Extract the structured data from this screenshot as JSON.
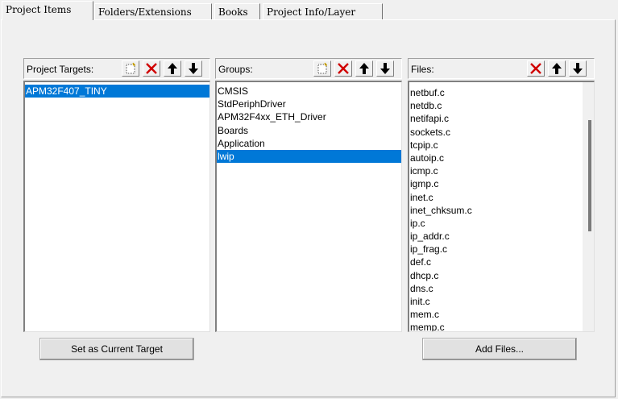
{
  "tabs": [
    {
      "label": "Project Items"
    },
    {
      "label": "Folders/Extensions"
    },
    {
      "label": "Books"
    },
    {
      "label": "Project Info/Layer"
    }
  ],
  "targets_panel": {
    "title": "Project Targets:",
    "items": [
      "APM32F407_TINY"
    ],
    "selected": "APM32F407_TINY"
  },
  "groups_panel": {
    "title": "Groups:",
    "items": [
      "CMSIS",
      "StdPeriphDriver",
      "APM32F4xx_ETH_Driver",
      "Boards",
      "Application",
      "lwip"
    ],
    "selected": "lwip"
  },
  "files_panel": {
    "title": "Files:",
    "items": [
      "netbuf.c",
      "netdb.c",
      "netifapi.c",
      "sockets.c",
      "tcpip.c",
      "autoip.c",
      "icmp.c",
      "igmp.c",
      "inet.c",
      "inet_chksum.c",
      "ip.c",
      "ip_addr.c",
      "ip_frag.c",
      "def.c",
      "dhcp.c",
      "dns.c",
      "init.c",
      "mem.c",
      "memp.c"
    ],
    "scroll_position": 0.16
  },
  "buttons": {
    "set_current_target": "Set as Current Target",
    "add_files": "Add Files..."
  },
  "toolbar_icons": [
    "new-icon",
    "delete-icon",
    "move-up-icon",
    "move-down-icon"
  ],
  "colors": {
    "selection": "#0078d7",
    "delete_icon": "#d00000"
  }
}
